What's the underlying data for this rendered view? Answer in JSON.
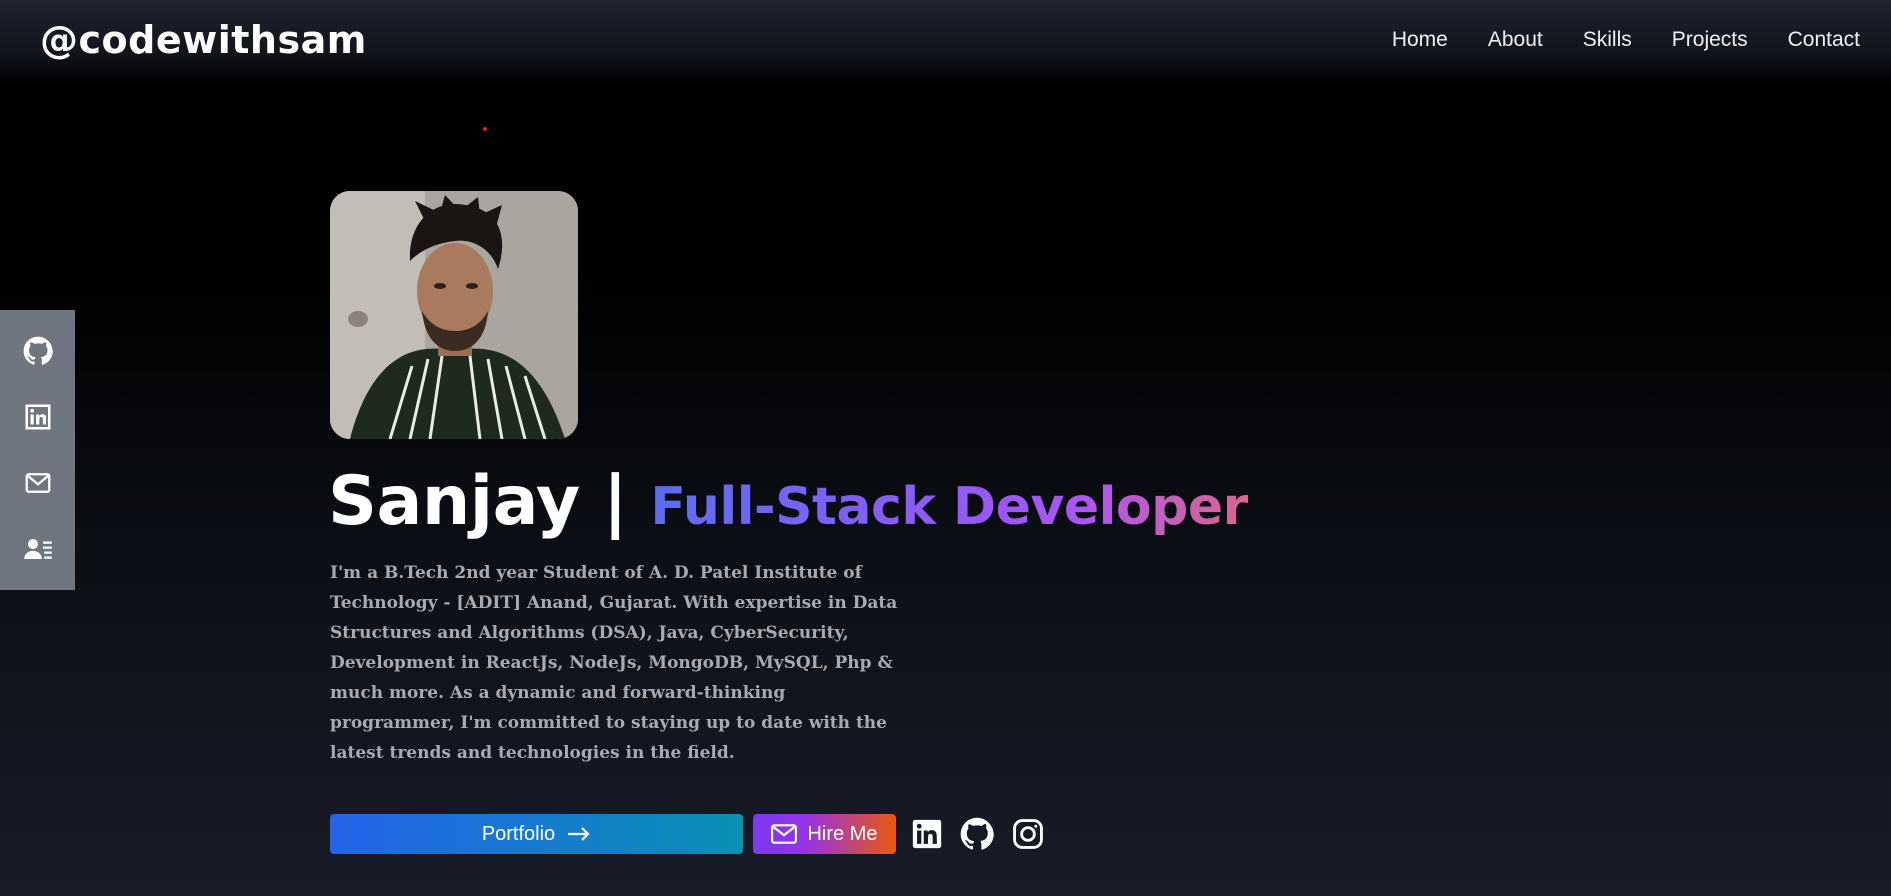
{
  "brand": "@codewithsam",
  "nav": [
    {
      "label": "Home"
    },
    {
      "label": "About"
    },
    {
      "label": "Skills"
    },
    {
      "label": "Projects"
    },
    {
      "label": "Contact"
    }
  ],
  "sidebar": {
    "items": [
      {
        "icon": "github-icon"
      },
      {
        "icon": "linkedin-icon"
      },
      {
        "icon": "mail-icon"
      },
      {
        "icon": "resume-icon"
      }
    ],
    "bg_color": "#6f7680"
  },
  "hero": {
    "name": "Sanjay",
    "separator": "|",
    "role": "Full-Stack Developer",
    "bio": "I'm a B.Tech 2nd year Student of A. D. Patel Institute of Technology - [ADIT] Anand, Gujarat. With expertise in Data Structures and Algorithms (DSA), Java, CyberSecurity, Development in ReactJs, NodeJs, MongoDB, MySQL, Php & much more. As a dynamic and forward-thinking programmer, I'm committed to staying up to date with the latest trends and technologies in the field."
  },
  "buttons": {
    "portfolio_label": "Portfolio",
    "portfolio_icon": "arrow-right-icon",
    "hire_label": "Hire Me",
    "hire_icon": "mail-icon"
  },
  "social": [
    {
      "icon": "linkedin-icon"
    },
    {
      "icon": "github-icon"
    },
    {
      "icon": "instagram-icon"
    }
  ],
  "colors": {
    "role_gradient": [
      "#5b6ef0",
      "#a855f7",
      "#d9668c"
    ],
    "portfolio_gradient": [
      "#2563eb",
      "#0891b2"
    ],
    "hire_gradient": [
      "#7c3aed",
      "#ea580c"
    ]
  }
}
